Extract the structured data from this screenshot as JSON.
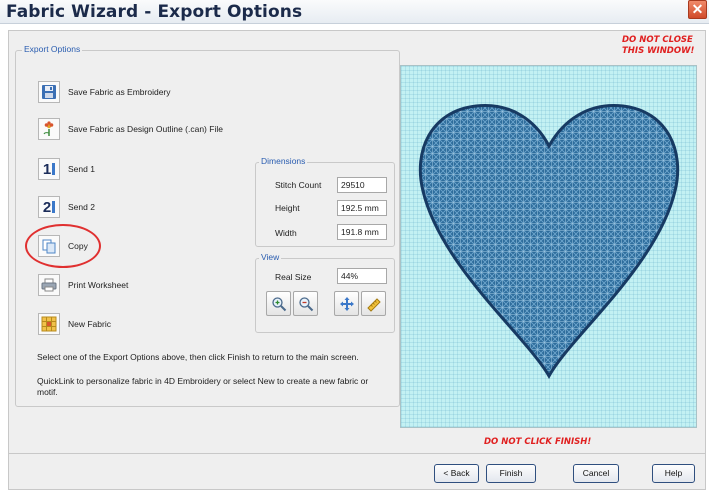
{
  "window": {
    "title": "Fabric Wizard - Export Options",
    "close_glyph": "✕"
  },
  "warnings": {
    "close_line1": "DO NOT CLOSE",
    "close_line2": "THIS WINDOW!",
    "finish": "DO NOT CLICK FINISH!"
  },
  "export_options": {
    "group_label": "Export Options",
    "items": [
      {
        "label": "Save Fabric as Embroidery",
        "icon": "floppy-disk-icon"
      },
      {
        "label": "Save Fabric as Design Outline (.can) File",
        "icon": "flower-outline-icon"
      },
      {
        "label": "Send 1",
        "icon": "send-1-icon",
        "icon_text": "1"
      },
      {
        "label": "Send 2",
        "icon": "send-2-icon",
        "icon_text": "2"
      },
      {
        "label": "Copy",
        "icon": "copy-icon"
      },
      {
        "label": "Print Worksheet",
        "icon": "printer-icon"
      },
      {
        "label": "New Fabric",
        "icon": "new-fabric-icon"
      }
    ],
    "info_line1": "Select one of the Export Options above, then click Finish to return to the main screen.",
    "info_line2": "QuickLink to personalize fabric in 4D Embroidery or select New to create a new fabric or motif."
  },
  "dimensions": {
    "group_label": "Dimensions",
    "stitch_count_label": "Stitch Count",
    "stitch_count_value": "29510",
    "height_label": "Height",
    "height_value": "192.5 mm",
    "width_label": "Width",
    "width_value": "191.8 mm"
  },
  "view": {
    "group_label": "View",
    "real_size_label": "Real Size",
    "real_size_value": "44%",
    "tools": [
      "zoom-in-icon",
      "zoom-out-icon",
      "pan-icon",
      "measure-icon"
    ]
  },
  "preview": {
    "shape": "heart",
    "fill_color": "#2e6d9c",
    "outline_color": "#173a63",
    "background_color": "#c3f1f3"
  },
  "buttons": {
    "back": "< Back",
    "finish": "Finish",
    "cancel": "Cancel",
    "help": "Help"
  },
  "colors": {
    "warning": "#e02020",
    "group_label": "#2a5db0",
    "annotation_circle": "#e03030"
  }
}
